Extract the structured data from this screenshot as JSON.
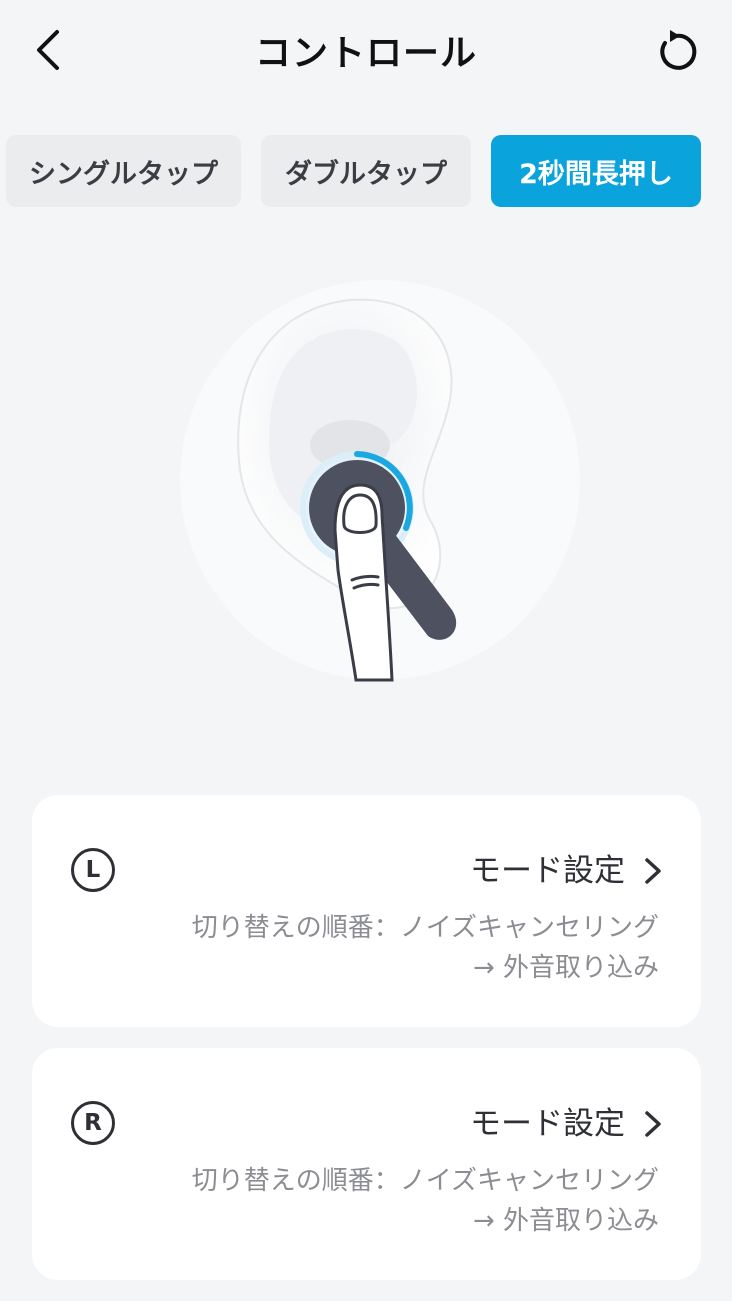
{
  "header": {
    "title": "コントロール",
    "back_icon": "chevron-left-icon",
    "reset_icon": "reset-icon"
  },
  "tabs": [
    {
      "label": "シングルタップ",
      "active": false
    },
    {
      "label": "ダブルタップ",
      "active": false
    },
    {
      "label": "2秒間長押し",
      "active": true
    }
  ],
  "colors": {
    "accent": "#0aa3dc",
    "background": "#f4f5f7",
    "card": "#ffffff"
  },
  "cards": [
    {
      "side": "L",
      "mode_title": "モード設定",
      "order_line1": "切り替えの順番：ノイズキャンセリング",
      "order_line2": "→ 外音取り込み"
    },
    {
      "side": "R",
      "mode_title": "モード設定",
      "order_line1": "切り替えの順番：ノイズキャンセリング",
      "order_line2": "→ 外音取り込み"
    }
  ]
}
